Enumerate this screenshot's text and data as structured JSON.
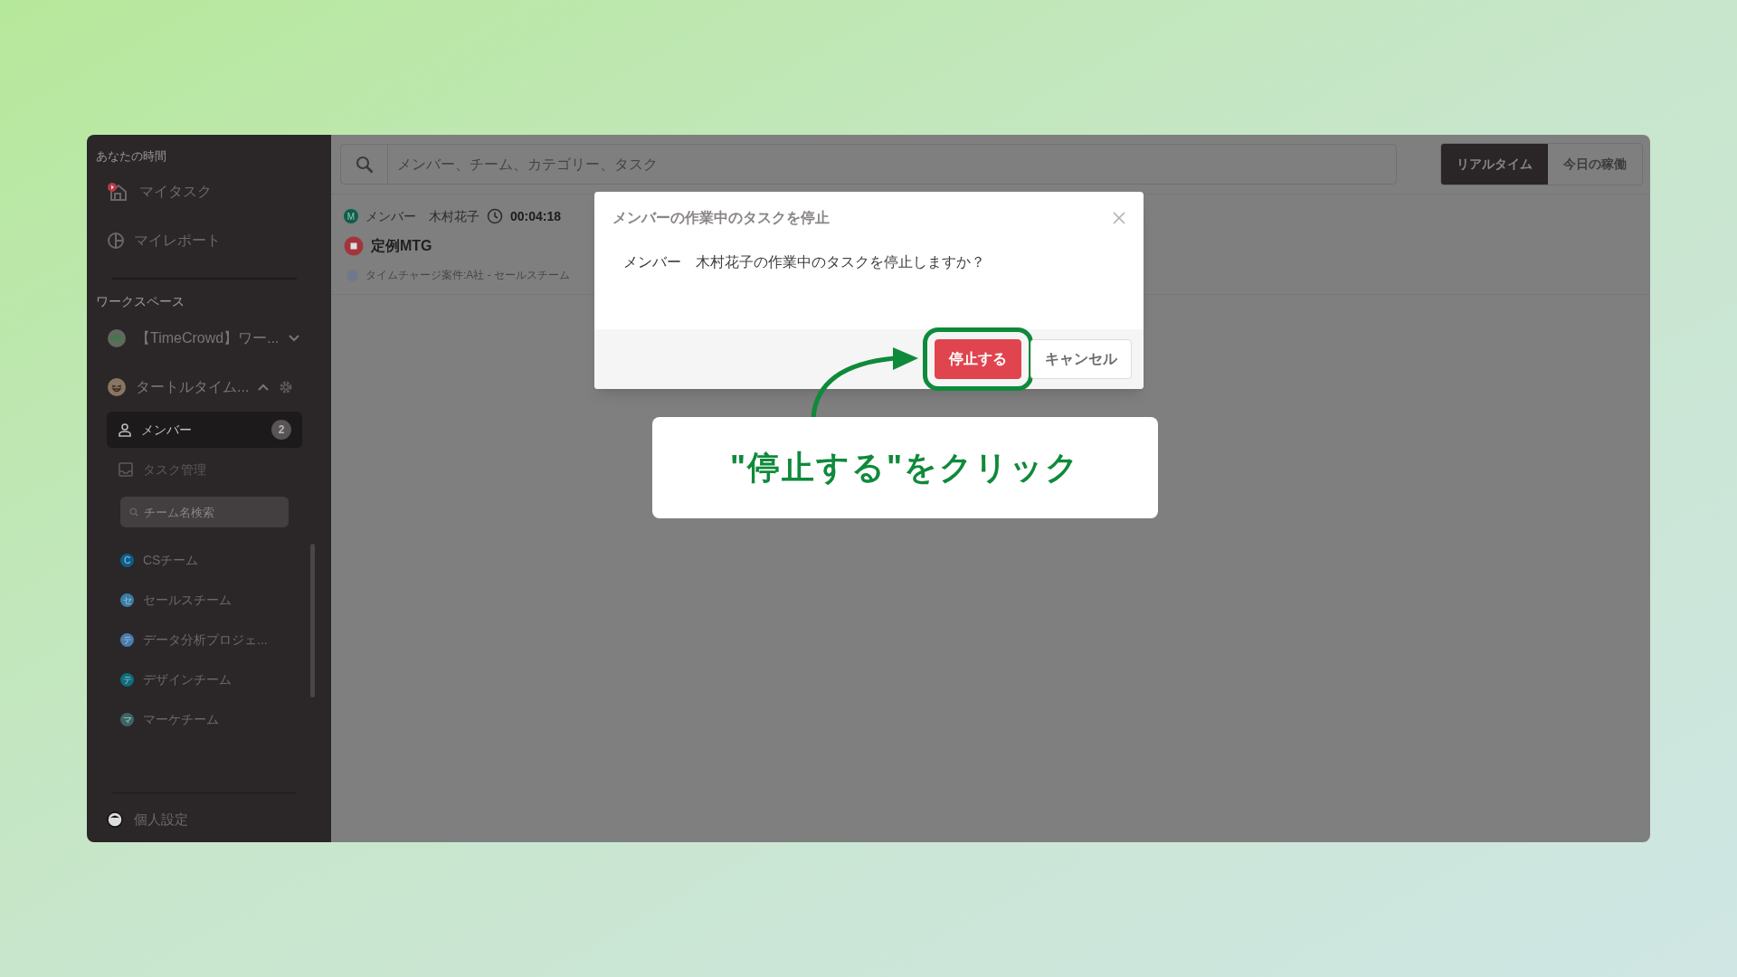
{
  "sidebar": {
    "section_title": "あなたの時間",
    "nav": [
      {
        "label": "マイタスク",
        "kind": "tasks"
      },
      {
        "label": "マイレポート",
        "kind": "report"
      }
    ],
    "workspace_title": "ワークスペース",
    "workspaces": [
      {
        "name": "【TimeCrowd】ワー...",
        "expanded": false
      },
      {
        "name": "タートルタイム...",
        "expanded": true
      }
    ],
    "menu": [
      {
        "label": "メンバー",
        "badge": "2",
        "selected": true,
        "kind": "members"
      },
      {
        "label": "タスク管理",
        "selected": false,
        "kind": "tasks"
      }
    ],
    "team_search": {
      "placeholder": "チーム名検索"
    },
    "teams": [
      {
        "initial": "C",
        "name": "CSチーム",
        "color": "#0b5f8f"
      },
      {
        "initial": "セ",
        "name": "セールスチーム",
        "color": "#3a7ea8"
      },
      {
        "initial": "テ",
        "name": "データ分析プロジェ...",
        "color": "#4a7cb0"
      },
      {
        "initial": "テ",
        "name": "デザインチーム",
        "color": "#0c6e7e"
      },
      {
        "initial": "マ",
        "name": "マーケチーム",
        "color": "#3c6568"
      }
    ],
    "footer": {
      "label": "個人設定"
    }
  },
  "search": {
    "placeholder": "メンバー、チーム、カテゴリー、タスク"
  },
  "view_tabs": [
    {
      "label": "リアルタイム",
      "selected": true
    },
    {
      "label": "今日の稼働",
      "selected": false
    }
  ],
  "activity": {
    "member_initial": "M",
    "member": "メンバー　木村花子",
    "elapsed": "00:04:18",
    "task": "定例MTG",
    "project": "タイムチャージ案件:A社 - セールスチーム"
  },
  "dialog": {
    "title": "メンバーの作業中のタスクを停止",
    "message": "メンバー　木村花子の作業中のタスクを停止しますか？",
    "buttons": [
      {
        "label": "停止する",
        "kind": "primary",
        "highlighted": true
      },
      {
        "label": "キャンセル",
        "kind": "secondary",
        "highlighted": false
      }
    ]
  },
  "callout": {
    "text": "\"停止する\"をクリック"
  }
}
